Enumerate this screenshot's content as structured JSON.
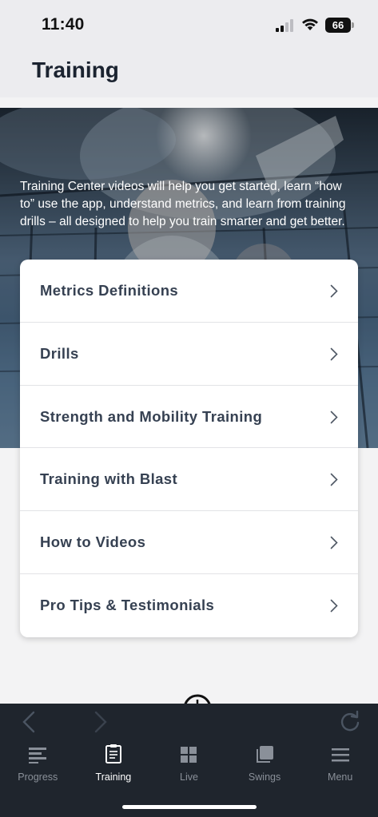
{
  "status_bar": {
    "time": "11:40",
    "battery": "66"
  },
  "header": {
    "title": "Training"
  },
  "hero": {
    "text": "Training Center videos will help you get started, learn “how to” use the app, understand metrics, and learn from training drills – all designed to help you train smarter and get better."
  },
  "menu": {
    "items": [
      {
        "label": "Metrics Definitions"
      },
      {
        "label": "Drills"
      },
      {
        "label": "Strength and Mobility Training"
      },
      {
        "label": "Training with Blast"
      },
      {
        "label": "How to Videos"
      },
      {
        "label": "Pro Tips & Testimonials"
      }
    ]
  },
  "tab_bar": {
    "active": "Training",
    "tabs": [
      {
        "label": "Progress",
        "icon": "progress-icon"
      },
      {
        "label": "Training",
        "icon": "clipboard-icon"
      },
      {
        "label": "Live",
        "icon": "live-grid-icon"
      },
      {
        "label": "Swings",
        "icon": "swings-stack-icon"
      },
      {
        "label": "Menu",
        "icon": "hamburger-menu-icon"
      }
    ]
  },
  "colors": {
    "header_bg": "#ececef",
    "title": "#1b2330",
    "menu_text": "#364152",
    "bottom_bar": "#1f252d",
    "tab_active": "#ffffff",
    "tab_inactive": "#8a9099"
  }
}
